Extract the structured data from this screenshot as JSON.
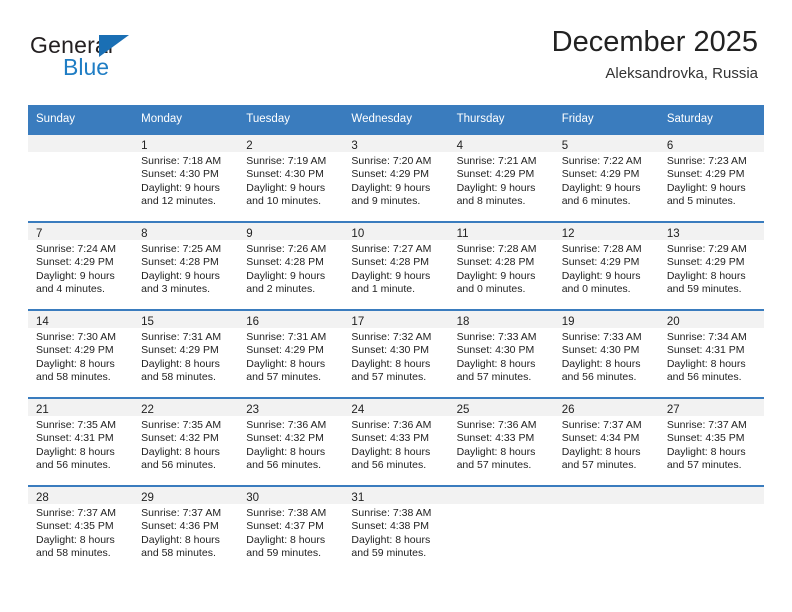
{
  "brand": {
    "name_top": "General",
    "name_bottom": "Blue",
    "triangle_color": "#1a6fb4",
    "text_color": "#231f20",
    "blue_color": "#1f7dc4"
  },
  "header": {
    "title": "December 2025",
    "subtitle": "Aleksandrovka, Russia",
    "accent_color": "#3a7cbe"
  },
  "calendar": {
    "weekday_headers": [
      "Sunday",
      "Monday",
      "Tuesday",
      "Wednesday",
      "Thursday",
      "Friday",
      "Saturday"
    ],
    "header_bg": "#3a7cbe",
    "header_text": "#ffffff",
    "daynum_band_bg": "#f2f2f2",
    "weeks": [
      [
        {
          "day": "",
          "lines": []
        },
        {
          "day": "1",
          "lines": [
            "Sunrise: 7:18 AM",
            "Sunset: 4:30 PM",
            "Daylight: 9 hours",
            "and 12 minutes."
          ]
        },
        {
          "day": "2",
          "lines": [
            "Sunrise: 7:19 AM",
            "Sunset: 4:30 PM",
            "Daylight: 9 hours",
            "and 10 minutes."
          ]
        },
        {
          "day": "3",
          "lines": [
            "Sunrise: 7:20 AM",
            "Sunset: 4:29 PM",
            "Daylight: 9 hours",
            "and 9 minutes."
          ]
        },
        {
          "day": "4",
          "lines": [
            "Sunrise: 7:21 AM",
            "Sunset: 4:29 PM",
            "Daylight: 9 hours",
            "and 8 minutes."
          ]
        },
        {
          "day": "5",
          "lines": [
            "Sunrise: 7:22 AM",
            "Sunset: 4:29 PM",
            "Daylight: 9 hours",
            "and 6 minutes."
          ]
        },
        {
          "day": "6",
          "lines": [
            "Sunrise: 7:23 AM",
            "Sunset: 4:29 PM",
            "Daylight: 9 hours",
            "and 5 minutes."
          ]
        }
      ],
      [
        {
          "day": "7",
          "lines": [
            "Sunrise: 7:24 AM",
            "Sunset: 4:29 PM",
            "Daylight: 9 hours",
            "and 4 minutes."
          ]
        },
        {
          "day": "8",
          "lines": [
            "Sunrise: 7:25 AM",
            "Sunset: 4:28 PM",
            "Daylight: 9 hours",
            "and 3 minutes."
          ]
        },
        {
          "day": "9",
          "lines": [
            "Sunrise: 7:26 AM",
            "Sunset: 4:28 PM",
            "Daylight: 9 hours",
            "and 2 minutes."
          ]
        },
        {
          "day": "10",
          "lines": [
            "Sunrise: 7:27 AM",
            "Sunset: 4:28 PM",
            "Daylight: 9 hours",
            "and 1 minute."
          ]
        },
        {
          "day": "11",
          "lines": [
            "Sunrise: 7:28 AM",
            "Sunset: 4:28 PM",
            "Daylight: 9 hours",
            "and 0 minutes."
          ]
        },
        {
          "day": "12",
          "lines": [
            "Sunrise: 7:28 AM",
            "Sunset: 4:29 PM",
            "Daylight: 9 hours",
            "and 0 minutes."
          ]
        },
        {
          "day": "13",
          "lines": [
            "Sunrise: 7:29 AM",
            "Sunset: 4:29 PM",
            "Daylight: 8 hours",
            "and 59 minutes."
          ]
        }
      ],
      [
        {
          "day": "14",
          "lines": [
            "Sunrise: 7:30 AM",
            "Sunset: 4:29 PM",
            "Daylight: 8 hours",
            "and 58 minutes."
          ]
        },
        {
          "day": "15",
          "lines": [
            "Sunrise: 7:31 AM",
            "Sunset: 4:29 PM",
            "Daylight: 8 hours",
            "and 58 minutes."
          ]
        },
        {
          "day": "16",
          "lines": [
            "Sunrise: 7:31 AM",
            "Sunset: 4:29 PM",
            "Daylight: 8 hours",
            "and 57 minutes."
          ]
        },
        {
          "day": "17",
          "lines": [
            "Sunrise: 7:32 AM",
            "Sunset: 4:30 PM",
            "Daylight: 8 hours",
            "and 57 minutes."
          ]
        },
        {
          "day": "18",
          "lines": [
            "Sunrise: 7:33 AM",
            "Sunset: 4:30 PM",
            "Daylight: 8 hours",
            "and 57 minutes."
          ]
        },
        {
          "day": "19",
          "lines": [
            "Sunrise: 7:33 AM",
            "Sunset: 4:30 PM",
            "Daylight: 8 hours",
            "and 56 minutes."
          ]
        },
        {
          "day": "20",
          "lines": [
            "Sunrise: 7:34 AM",
            "Sunset: 4:31 PM",
            "Daylight: 8 hours",
            "and 56 minutes."
          ]
        }
      ],
      [
        {
          "day": "21",
          "lines": [
            "Sunrise: 7:35 AM",
            "Sunset: 4:31 PM",
            "Daylight: 8 hours",
            "and 56 minutes."
          ]
        },
        {
          "day": "22",
          "lines": [
            "Sunrise: 7:35 AM",
            "Sunset: 4:32 PM",
            "Daylight: 8 hours",
            "and 56 minutes."
          ]
        },
        {
          "day": "23",
          "lines": [
            "Sunrise: 7:36 AM",
            "Sunset: 4:32 PM",
            "Daylight: 8 hours",
            "and 56 minutes."
          ]
        },
        {
          "day": "24",
          "lines": [
            "Sunrise: 7:36 AM",
            "Sunset: 4:33 PM",
            "Daylight: 8 hours",
            "and 56 minutes."
          ]
        },
        {
          "day": "25",
          "lines": [
            "Sunrise: 7:36 AM",
            "Sunset: 4:33 PM",
            "Daylight: 8 hours",
            "and 57 minutes."
          ]
        },
        {
          "day": "26",
          "lines": [
            "Sunrise: 7:37 AM",
            "Sunset: 4:34 PM",
            "Daylight: 8 hours",
            "and 57 minutes."
          ]
        },
        {
          "day": "27",
          "lines": [
            "Sunrise: 7:37 AM",
            "Sunset: 4:35 PM",
            "Daylight: 8 hours",
            "and 57 minutes."
          ]
        }
      ],
      [
        {
          "day": "28",
          "lines": [
            "Sunrise: 7:37 AM",
            "Sunset: 4:35 PM",
            "Daylight: 8 hours",
            "and 58 minutes."
          ]
        },
        {
          "day": "29",
          "lines": [
            "Sunrise: 7:37 AM",
            "Sunset: 4:36 PM",
            "Daylight: 8 hours",
            "and 58 minutes."
          ]
        },
        {
          "day": "30",
          "lines": [
            "Sunrise: 7:38 AM",
            "Sunset: 4:37 PM",
            "Daylight: 8 hours",
            "and 59 minutes."
          ]
        },
        {
          "day": "31",
          "lines": [
            "Sunrise: 7:38 AM",
            "Sunset: 4:38 PM",
            "Daylight: 8 hours",
            "and 59 minutes."
          ]
        },
        {
          "day": "",
          "lines": []
        },
        {
          "day": "",
          "lines": []
        },
        {
          "day": "",
          "lines": []
        }
      ]
    ]
  }
}
